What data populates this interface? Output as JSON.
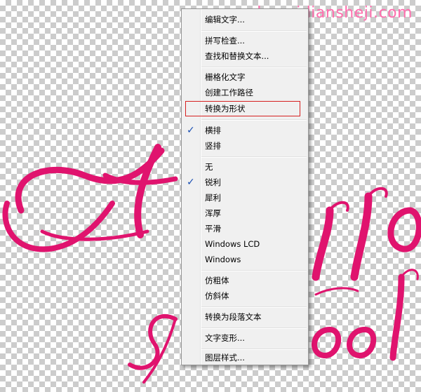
{
  "watermark": {
    "text": "www.haoyidiansheji.com"
  },
  "canvas": {
    "text_color": "#e0136e",
    "line1": "Hello",
    "line2": "School"
  },
  "menu": {
    "items": [
      {
        "label": "编辑文字..."
      },
      {
        "label": "拼写检查..."
      },
      {
        "label": "查找和替换文本..."
      },
      {
        "label": "栅格化文字"
      },
      {
        "label": "创建工作路径"
      },
      {
        "label": "转换为形状"
      },
      {
        "label": "横排",
        "checked": true
      },
      {
        "label": "竖排"
      },
      {
        "label": "无"
      },
      {
        "label": "锐利",
        "checked": true
      },
      {
        "label": "犀利"
      },
      {
        "label": "浑厚"
      },
      {
        "label": "平滑"
      },
      {
        "label": "Windows LCD"
      },
      {
        "label": "Windows"
      },
      {
        "label": "仿粗体"
      },
      {
        "label": "仿斜体"
      },
      {
        "label": "转换为段落文本"
      },
      {
        "label": "文字变形..."
      },
      {
        "label": "图层样式..."
      }
    ],
    "check_icon": "checkmark-icon",
    "check_glyph": "✓"
  }
}
